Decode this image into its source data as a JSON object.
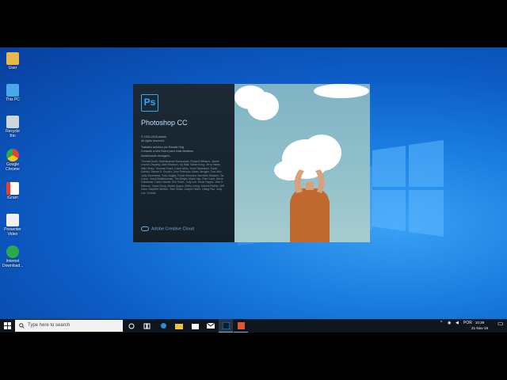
{
  "desktop": {
    "icons": [
      {
        "label": "User",
        "icon": "user-folder-icon",
        "color": "#e8b84a"
      },
      {
        "label": "This PC",
        "icon": "this-pc-icon",
        "color": "#4aa7e8"
      },
      {
        "label": "Recycle Bin",
        "icon": "recycle-bin-icon",
        "color": "#cfd6dd"
      },
      {
        "label": "Google Chrome",
        "icon": "chrome-icon",
        "color": "#e44134"
      },
      {
        "label": "iGram",
        "icon": "app-icon",
        "color": "#ffffff"
      },
      {
        "label": "Presenter Video",
        "icon": "video-icon",
        "color": "#f0f0f0"
      },
      {
        "label": "Internet Download...",
        "icon": "download-manager-icon",
        "color": "#2ca94f"
      }
    ]
  },
  "splash": {
    "app_logo": "Ps",
    "app_name": "Photoshop CC",
    "copyright": "© 1990-2018 Adobe.",
    "rights": "All rights reserved.",
    "artwork_by": "Trabalho artístico por Ronald Ong",
    "legal_link": "Consulte a tela Sobre para mais detalhes",
    "status": "Inicializando docagem...",
    "credits": "Thomas Knoll, Seetharaman Narayanan, Russell Williams, Jackie Lincoln-Owyang, Alan Erickson, Ivy Mak, Sarah Kong, Jerry Harris, Mike Shaw, Thomas Ruark, David Mohr, Yukie Takahashi, David Dobish, Steven E. Snyder, John Peterson, Adam Jerugim, Tom Attix, Judy Severance, Yuko Kagita, Foster Brereton, Meredith Stotzner, Tai Luxon, Vinod Balakrishnan, Tim Wright, Maria Yap, Pam Clark, Steve Guilhamet, David Hackel, Eric Floch, Judy Lee, Kevin Hopps, John E. Hanson, Yuyan Song, Barkin Aygun, Betty Leong, Jeanne Rubbo, Jeff Sass, Stephen Nielson, Seth Shaw, Joseph Hsieh, I-Ming Pao, Judy Lee, Sohrab",
    "footer": "Adobe Creative Cloud",
    "accent": "#31a8ff"
  },
  "taskbar": {
    "search_placeholder": "Type here to search",
    "pinned": [
      "cortana-icon",
      "task-view-icon",
      "edge-icon",
      "file-explorer-icon",
      "store-icon",
      "mail-icon",
      "photoshop-icon",
      "office-icon"
    ],
    "tray_lang": "POR",
    "time": "10:39",
    "date": "21-Nov-19"
  }
}
